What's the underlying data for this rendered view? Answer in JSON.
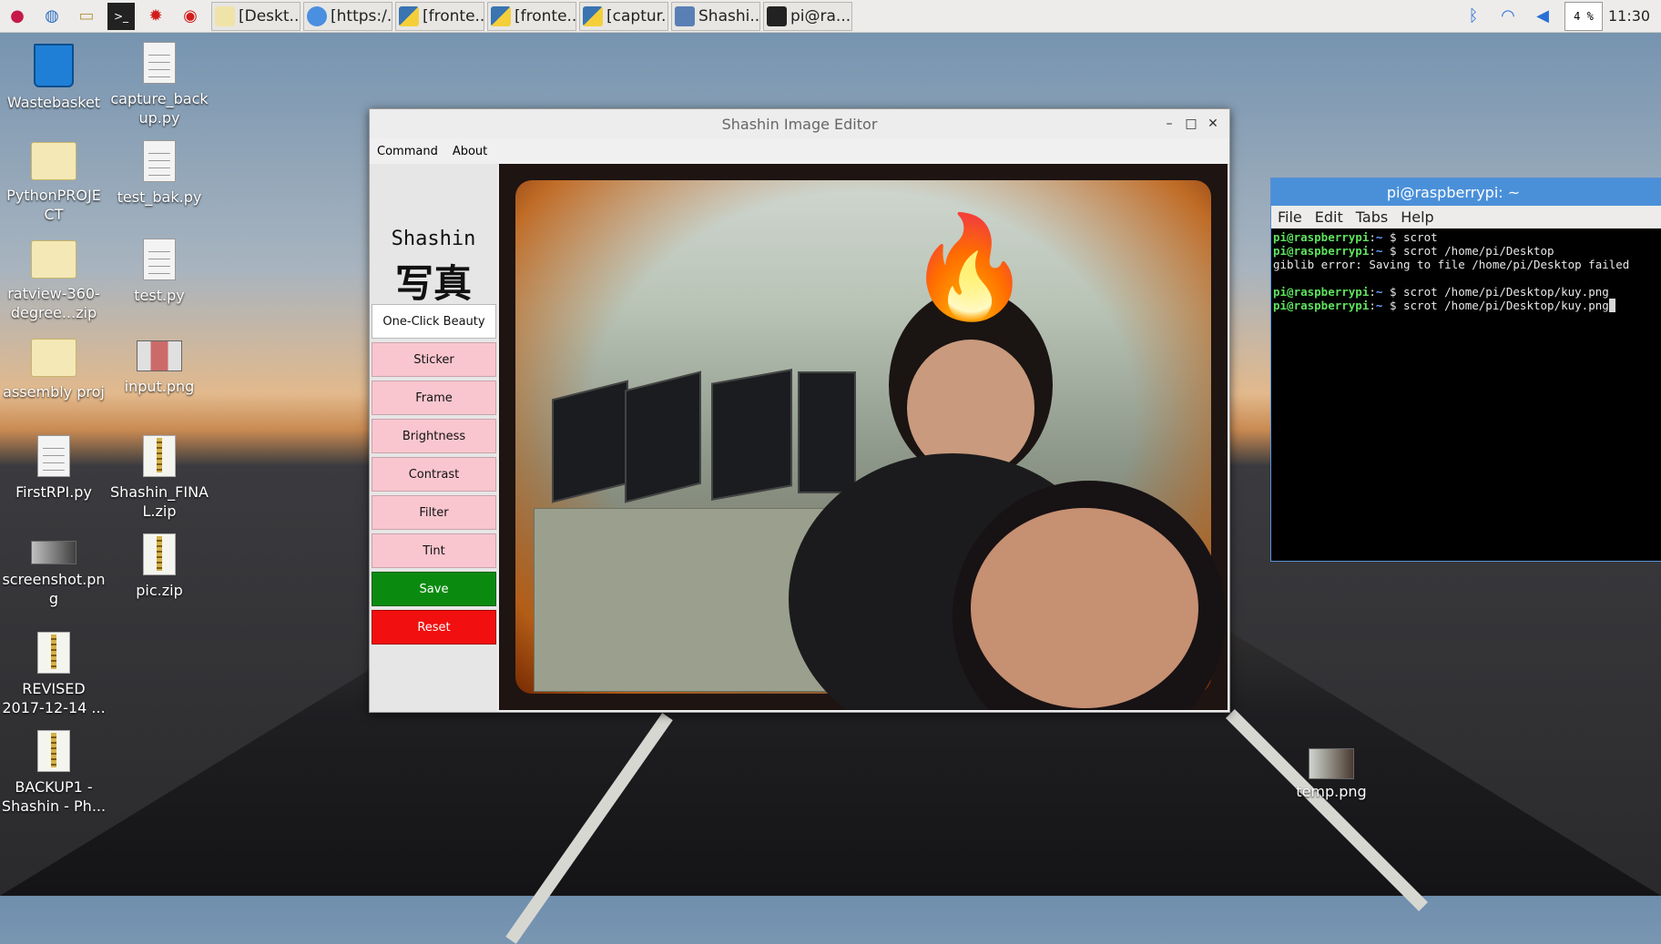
{
  "taskbar": {
    "launchers": [
      "raspberry-menu",
      "web-browser",
      "file-manager",
      "terminal",
      "mathematica",
      "wolfram"
    ],
    "tasks": [
      {
        "label": "[Deskt...",
        "icon": "folder-icon"
      },
      {
        "label": "[https:/...",
        "icon": "chromium-icon"
      },
      {
        "label": "[fronte...",
        "icon": "python-icon"
      },
      {
        "label": "[fronte...",
        "icon": "python-icon"
      },
      {
        "label": "[captur...",
        "icon": "python-icon"
      },
      {
        "label": "Shashi...",
        "icon": "window-icon"
      },
      {
        "label": "pi@ra...",
        "icon": "terminal-icon"
      }
    ],
    "cpu": "4 %",
    "clock": "11:30"
  },
  "desktop_icons": {
    "wastebasket": "Wastebasket",
    "capture_backup": "capture_back up.py",
    "python_project": "PythonPROJE CT",
    "test_bak": "test_bak.py",
    "ratview": "ratview-360-degree...zip",
    "test_py": "test.py",
    "assembly_proj": "assembly proj",
    "input_png": "input.png",
    "firstrpi": "FirstRPI.py",
    "shashin_final": "Shashin_FINA L.zip",
    "screenshot": "screenshot.pn g",
    "pic_zip": "pic.zip",
    "revised": "REVISED 2017-12-14 ...",
    "backup1": "BACKUP1 - Shashin - Ph...",
    "temp_png": "temp.png"
  },
  "editor": {
    "title": "Shashin Image Editor",
    "menu": [
      "Command",
      "About"
    ],
    "logo_text": "Shashin",
    "logo_kanji": "写真",
    "buttons": {
      "one_click": "One-Click Beauty",
      "sticker": "Sticker",
      "frame": "Frame",
      "brightness": "Brightness",
      "contrast": "Contrast",
      "filter": "Filter",
      "tint": "Tint",
      "save": "Save",
      "reset": "Reset"
    },
    "sticker_emoji": "🔥"
  },
  "terminal": {
    "title": "pi@raspberrypi: ~",
    "menu": [
      "File",
      "Edit",
      "Tabs",
      "Help"
    ],
    "lines": [
      {
        "prompt": "pi@raspberrypi",
        "path": "~",
        "cmd": " $ scrot"
      },
      {
        "prompt": "pi@raspberrypi",
        "path": "~",
        "cmd": " $ scrot /home/pi/Desktop"
      },
      {
        "output": "giblib error: Saving to file /home/pi/Desktop failed"
      },
      {
        "output": ""
      },
      {
        "prompt": "pi@raspberrypi",
        "path": "~",
        "cmd": " $ scrot /home/pi/Desktop/kuy.png"
      },
      {
        "prompt": "pi@raspberrypi",
        "path": "~",
        "cmd": " $ scrot /home/pi/Desktop/kuy.png"
      }
    ]
  },
  "colors": {
    "button_pink": "#f9c6cf",
    "save_green": "#0b8a10",
    "reset_red": "#f20f0f",
    "terminal_title_blue": "#4a90d9"
  }
}
